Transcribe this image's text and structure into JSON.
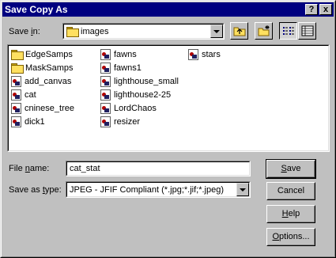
{
  "window": {
    "title": "Save Copy As"
  },
  "titlebar_buttons": {
    "help": "?",
    "close": "x"
  },
  "save_in": {
    "label_prefix": "Save ",
    "label_hotkey": "i",
    "label_suffix": "n:",
    "value": "images",
    "icon": "folder-icon"
  },
  "toolbar": {
    "up_folder": "up-one-level-icon",
    "new_folder": "create-new-folder-icon",
    "list_view": "list-view-icon",
    "details_view": "details-view-icon"
  },
  "files": {
    "col1": [
      {
        "name": "EdgeSamps",
        "type": "folder"
      },
      {
        "name": "MaskSamps",
        "type": "folder"
      },
      {
        "name": "add_canvas",
        "type": "image"
      },
      {
        "name": "cat",
        "type": "image"
      },
      {
        "name": "cninese_tree",
        "type": "image"
      },
      {
        "name": "dick1",
        "type": "image"
      }
    ],
    "col2": [
      {
        "name": "fawns",
        "type": "image"
      },
      {
        "name": "fawns1",
        "type": "image"
      },
      {
        "name": "lighthouse_small",
        "type": "image"
      },
      {
        "name": "lighthouse2-25",
        "type": "image"
      },
      {
        "name": "LordChaos",
        "type": "image"
      },
      {
        "name": "resizer",
        "type": "image"
      }
    ],
    "col3": [
      {
        "name": "stars",
        "type": "image"
      }
    ]
  },
  "file_name": {
    "label_prefix": "File ",
    "label_hotkey": "n",
    "label_suffix": "ame:",
    "value": "cat_stat"
  },
  "save_as_type": {
    "label_prefix": "Save as ",
    "label_hotkey": "t",
    "label_suffix": "ype:",
    "value": "JPEG - JFIF Compliant (*.jpg;*.jif;*.jpeg)"
  },
  "buttons": {
    "save_hotkey": "S",
    "save_rest": "ave",
    "cancel": "Cancel",
    "help_hotkey": "H",
    "help_rest": "elp",
    "options_hotkey": "O",
    "options_rest": "ptions..."
  }
}
